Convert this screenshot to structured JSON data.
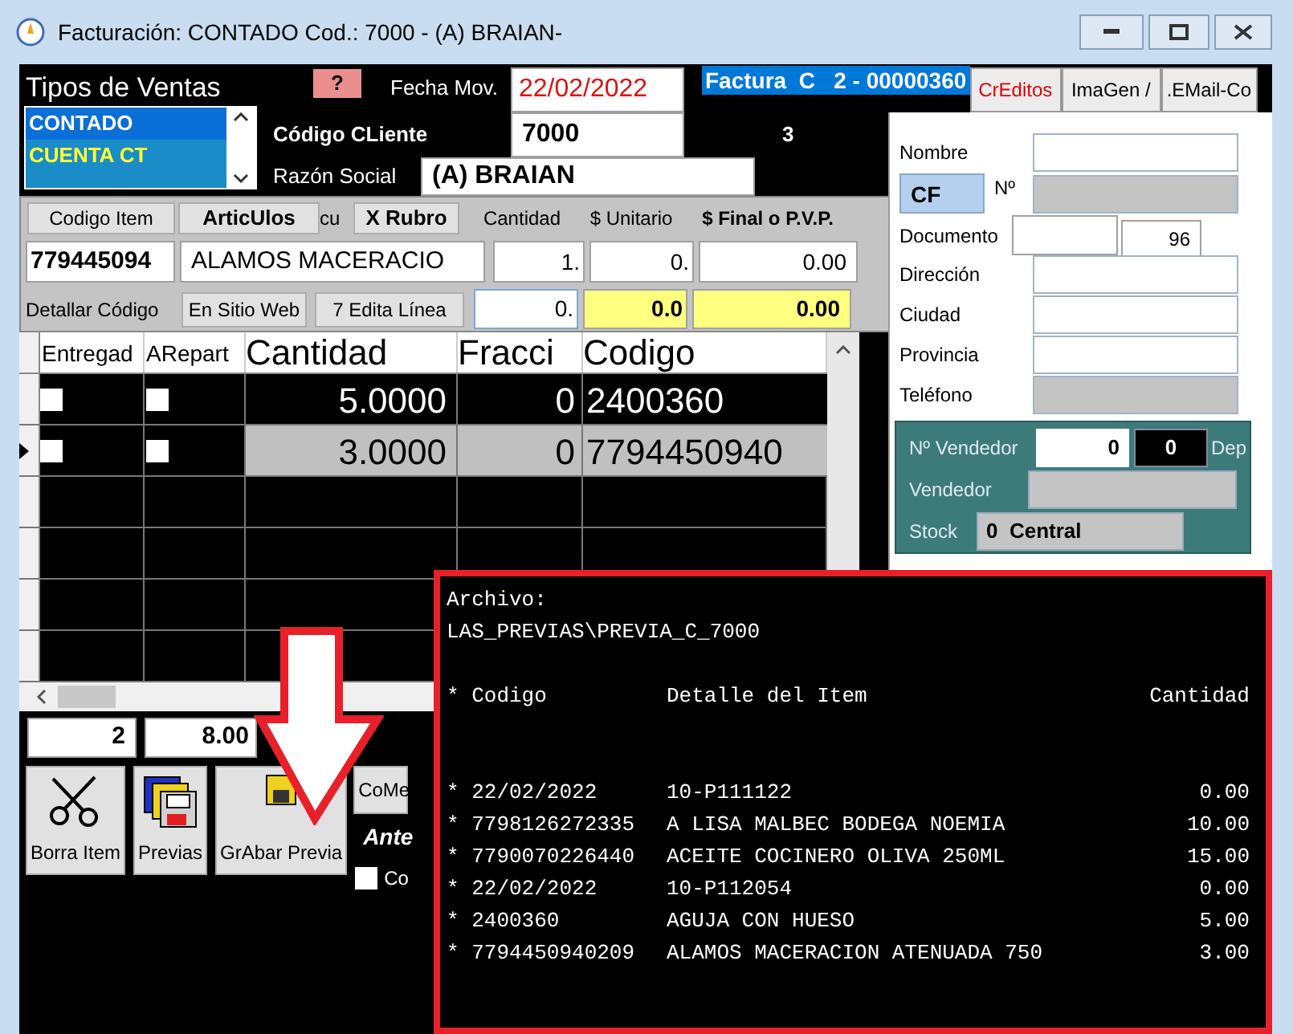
{
  "window": {
    "title": "Facturación: CONTADO Cod.: 7000 - (A) BRAIAN-"
  },
  "sales_types": {
    "label": "Tipos de Ventas",
    "items": [
      {
        "label": "CONTADO",
        "selected": true
      },
      {
        "label": "CUENTA CT",
        "selected": false
      }
    ]
  },
  "help_button": "?",
  "date": {
    "label": "Fecha Mov.",
    "value": "22/02/2022"
  },
  "invoice_number": "Factura  C   2 - 00000360",
  "tabs": [
    {
      "label": "CrEditos",
      "selected": false
    },
    {
      "label": "ImaGen /",
      "selected": false
    },
    {
      "label": ".EMail-Co",
      "selected": false
    }
  ],
  "customer": {
    "code_label": "Código CLiente",
    "code": "7000",
    "count": "3",
    "name_label": "Razón Social",
    "name": "(A) BRAIAN"
  },
  "item_entry": {
    "search_buttons": [
      "Codigo Item",
      "ArticUlos"
    ],
    "cut_label": "cu",
    "rubro_button": "X Rubro",
    "headers": [
      "Cantidad",
      "$ Unitario",
      "$ Final o P.V.P."
    ],
    "code": "779445094",
    "description": "ALAMOS MACERACIO",
    "quantity": "1.",
    "unit_price": "0.",
    "final_price": "0.00",
    "detail_label": "Detallar Código",
    "line_buttons": [
      "En Sitio Web",
      "7 Edita Línea"
    ],
    "quantity_2": "0.",
    "unit_price_2": "0.0",
    "final_price_2": "0.00"
  },
  "grid": {
    "columns": [
      "Entregad",
      "ARepart",
      "Cantidad",
      "Fracci",
      "Codigo"
    ],
    "rows": [
      {
        "delivered": false,
        "to_deliver": false,
        "quantity": "5.0000",
        "fraction": "0",
        "code": "2400360",
        "selected": false
      },
      {
        "delivered": false,
        "to_deliver": false,
        "quantity": "3.0000",
        "fraction": "0",
        "code": "7794450940",
        "selected": true
      }
    ]
  },
  "totals": [
    "2",
    "8.00"
  ],
  "actions": [
    {
      "label": "Borra Item",
      "kind": "scissors"
    },
    {
      "label": "Previas",
      "kind": "disks"
    },
    {
      "label": "GrAbar Previa",
      "kind": "disk"
    }
  ],
  "comments_button": "CoMe",
  "italic_label": "Ante",
  "checkbox": {
    "label": "Co",
    "checked": false
  },
  "client_panel": {
    "name_label": "Nombre",
    "fiscal_type": "CF",
    "number_label": "Nº",
    "document_label": "Documento",
    "document_code": "96",
    "address_label": "Dirección",
    "city_label": "Ciudad",
    "province_label": "Provincia",
    "phone_label": "Teléfono"
  },
  "seller_panel": {
    "number_label": "Nº Vendedor",
    "number": "0",
    "number_2": "0",
    "deposit_label": "Dep",
    "seller_label": "Vendedor",
    "stock_label": "Stock",
    "stock": "0  Central"
  },
  "preview": {
    "title": "Archivo:",
    "path": "LAS_PREVIAS\\PREVIA_C_7000",
    "header": [
      "* Codigo",
      "Detalle del Item",
      "Cantidad"
    ],
    "rows": [
      [
        "* 22/02/2022",
        "10-P111122",
        "0.00"
      ],
      [
        "* 7798126272335",
        "A LISA MALBEC BODEGA NOEMIA",
        "10.00"
      ],
      [
        "* 7790070226440",
        "ACEITE COCINERO OLIVA 250ML",
        "15.00"
      ],
      [
        "* 22/02/2022",
        "10-P112054",
        "0.00"
      ],
      [
        "* 2400360",
        "AGUJA CON HUESO",
        "5.00"
      ],
      [
        "* 7794450940209",
        "ALAMOS MACERACION ATENUADA 750",
        "3.00"
      ]
    ]
  }
}
